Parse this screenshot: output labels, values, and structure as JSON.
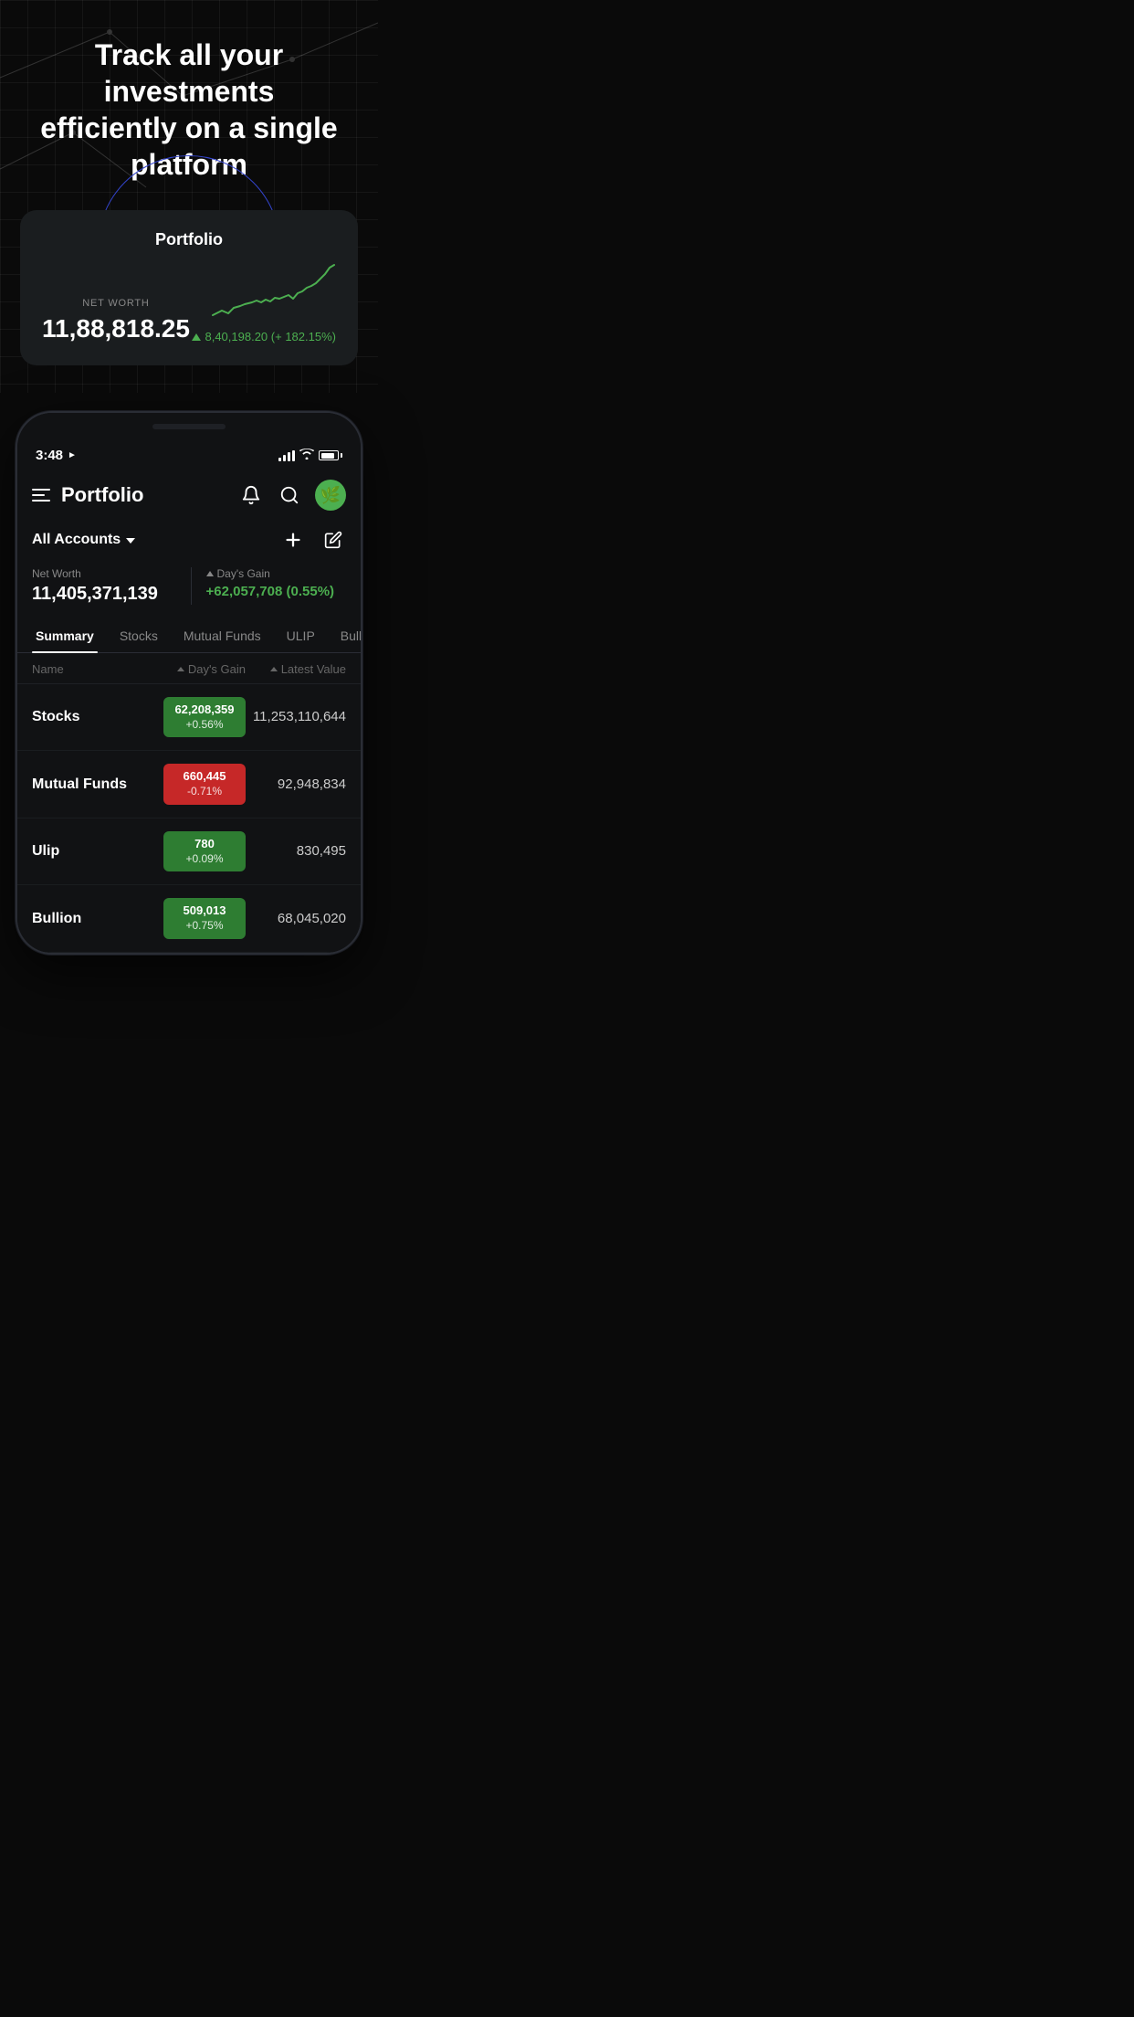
{
  "hero": {
    "title_line1": "Track all your investments",
    "title_line2": "efficiently on a single platform"
  },
  "portfolio_card": {
    "title": "Portfolio",
    "net_worth_label": "NET WORTH",
    "net_worth_value": "11,88,818.25",
    "gain_value": "8,40,198.20",
    "gain_pct": "+ 182.15%"
  },
  "status_bar": {
    "time": "3:48",
    "location_arrow": "▶"
  },
  "header": {
    "title": "Portfolio",
    "hamburger_label": "menu",
    "bell_label": "notifications",
    "search_label": "search",
    "avatar_emoji": "🌿"
  },
  "account_section": {
    "all_accounts_label": "All Accounts",
    "add_label": "+",
    "edit_label": "✏"
  },
  "net_worth": {
    "nw_label": "Net Worth",
    "nw_value": "11,405,371,139",
    "days_gain_label": "Day's Gain",
    "days_gain_value": "+62,057,708 (0.55%)"
  },
  "tabs": [
    {
      "label": "Summary",
      "active": true
    },
    {
      "label": "Stocks",
      "active": false
    },
    {
      "label": "Mutual Funds",
      "active": false
    },
    {
      "label": "ULIP",
      "active": false
    },
    {
      "label": "Bullion",
      "active": false
    }
  ],
  "table": {
    "col_name": "Name",
    "col_days_gain": "Day's Gain",
    "col_latest": "Latest Value",
    "rows": [
      {
        "name": "Stocks",
        "gain_value": "62,208,359",
        "gain_pct": "+0.56%",
        "gain_type": "green",
        "latest_value": "11,253,110,644"
      },
      {
        "name": "Mutual Funds",
        "gain_value": "660,445",
        "gain_pct": "-0.71%",
        "gain_type": "red",
        "latest_value": "92,948,834"
      },
      {
        "name": "Ulip",
        "gain_value": "780",
        "gain_pct": "+0.09%",
        "gain_type": "green",
        "latest_value": "830,495"
      },
      {
        "name": "Bullion",
        "gain_value": "509,013",
        "gain_pct": "+0.75%",
        "gain_type": "green",
        "latest_value": "68,045,020"
      }
    ]
  }
}
